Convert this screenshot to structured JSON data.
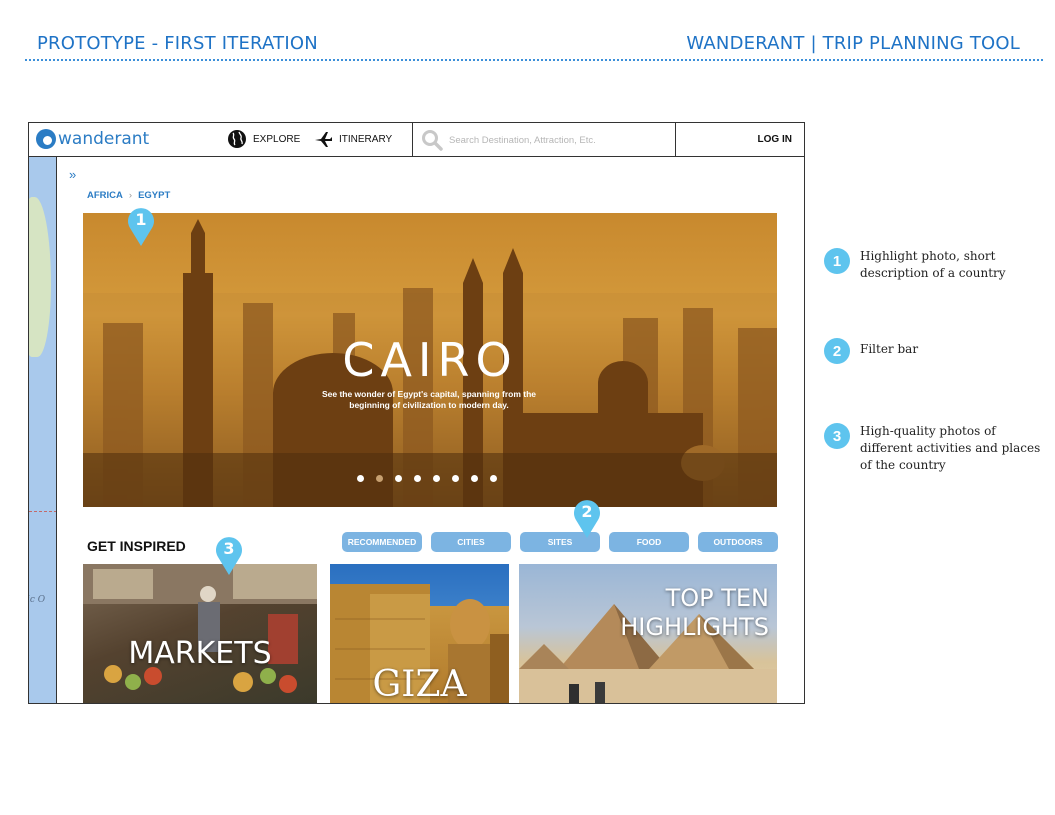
{
  "page": {
    "title_left": "PROTOTYPE - FIRST ITERATION",
    "title_right": "WANDERANT | TRIP PLANNING TOOL"
  },
  "app": {
    "logo_text": "wanderant",
    "nav": {
      "explore_label": "EXPLORE",
      "itinerary_label": "ITINERARY",
      "search_placeholder": "Search Destination, Attraction, Etc.",
      "login_label": "LOG IN"
    },
    "map_label": "ic O",
    "breadcrumb": [
      "AFRICA",
      "EGYPT"
    ],
    "hero": {
      "title": "CAIRO",
      "description": "See the wonder of Egypt's capital, spanning from the beginning of civilization to modern day.",
      "slide_count": 8,
      "active_slide": 2
    },
    "section_title": "GET INSPIRED",
    "filters": [
      "RECOMMENDED",
      "CITIES",
      "SITES",
      "FOOD",
      "OUTDOORS"
    ],
    "cards": [
      {
        "label": "MARKETS"
      },
      {
        "label": "GIZA"
      },
      {
        "label_line1": "TOP TEN",
        "label_line2": "HIGHLIGHTS"
      }
    ]
  },
  "callouts": [
    "1",
    "2",
    "3"
  ],
  "legend": [
    {
      "num": "1",
      "text_line1": "Highlight photo, short",
      "text_line2": "description of a country"
    },
    {
      "num": "2",
      "text_line1": "Filter bar"
    },
    {
      "num": "3",
      "text_line1": "High-quality photos of",
      "text_line2": "different activities and places",
      "text_line3": "of the country"
    }
  ],
  "colors": {
    "brand_blue": "#1f73c6",
    "filter_blue": "#7cb4e2",
    "callout_blue": "#5ec4ee"
  }
}
